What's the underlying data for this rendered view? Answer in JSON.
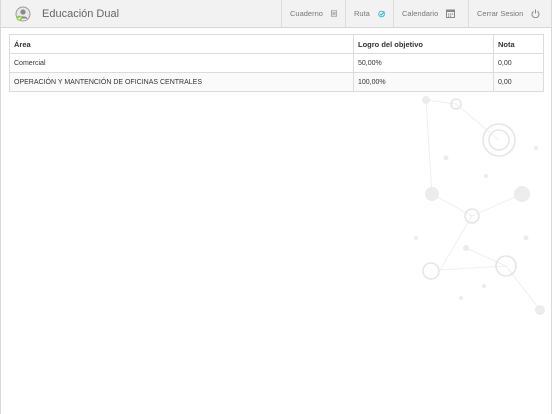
{
  "header": {
    "app_title": "Educación Dual",
    "nav": [
      {
        "label": "Cuaderno",
        "icon": "notebook-icon"
      },
      {
        "label": "Ruta",
        "icon": "check-circle-icon"
      },
      {
        "label": "Calendario",
        "icon": "calendar-icon"
      },
      {
        "label": "Cerrar Sesion",
        "icon": "power-icon"
      }
    ]
  },
  "colors": {
    "accent": "#2bb5c8",
    "logo_check": "#8dc63f"
  },
  "table": {
    "headers": [
      "Área",
      "Logro del objetivo",
      "Nota"
    ],
    "rows": [
      [
        "Comercial",
        "50,00%",
        "0,00"
      ],
      [
        "OPERACIÓN Y MANTENCIÓN DE OFICINAS CENTRALES",
        "100,00%",
        "0,00"
      ]
    ]
  }
}
